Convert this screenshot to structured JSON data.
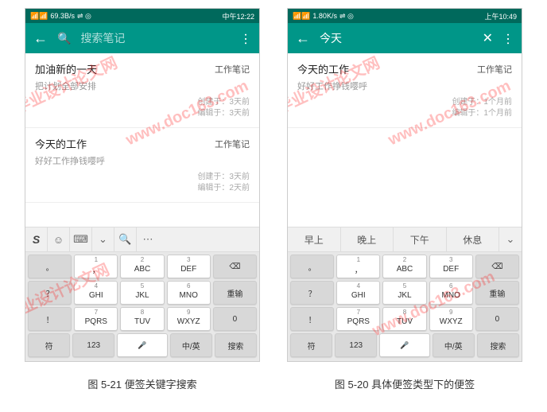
{
  "left": {
    "status": {
      "net": "69.3B/s",
      "icons": "⇌ ◎",
      "time": "中午12:22",
      "signal": "📶📶"
    },
    "toolbar": {
      "search_placeholder": "搜索笔记"
    },
    "notes": [
      {
        "title": "加油新的一天",
        "tag": "工作笔记",
        "sub": "把计划全部安排",
        "created": "创建于：3天前",
        "edited": "编辑于：3天前"
      },
      {
        "title": "今天的工作",
        "tag": "工作笔记",
        "sub": "好好工作挣钱嘤呼",
        "created": "创建于：3天前",
        "edited": "编辑于：2天前"
      }
    ],
    "suggest_icons": {
      "s": "S",
      "emoji": "☺",
      "kb": "⌨",
      "down": "⌄",
      "search": "🔍",
      "more": "⋯"
    }
  },
  "right": {
    "status": {
      "net": "1.80K/s",
      "icons": "⇌ ◎",
      "time": "上午10:49",
      "signal": "📶📶"
    },
    "toolbar": {
      "title": "今天"
    },
    "notes": [
      {
        "title": "今天的工作",
        "tag": "工作笔记",
        "sub": "好好工作挣钱嘤呼",
        "created": "创建于：1个月前",
        "edited": "编辑于：1个月前"
      }
    ],
    "suggest": [
      "早上",
      "晚上",
      "下午",
      "休息"
    ]
  },
  "keyboard": {
    "r1": [
      {
        "n": "1",
        "m": "，"
      },
      {
        "n": "2",
        "m": "ABC"
      },
      {
        "n": "3",
        "m": "DEF"
      }
    ],
    "r1_side": {
      "l": "。",
      "r": "⌫"
    },
    "r2": [
      {
        "n": "4",
        "m": "GHI"
      },
      {
        "n": "5",
        "m": "JKL"
      },
      {
        "n": "6",
        "m": "MNO"
      }
    ],
    "r2_side": {
      "l": "？",
      "r": "重输"
    },
    "r3": [
      {
        "n": "7",
        "m": "PQRS"
      },
      {
        "n": "8",
        "m": "TUV"
      },
      {
        "n": "9",
        "m": "WXYZ"
      }
    ],
    "r3_side": {
      "l": "！",
      "r": "0"
    },
    "r4": [
      "符",
      "123",
      "🎤",
      "中/英",
      "搜索"
    ]
  },
  "captions": {
    "left": "图 5-21 便签关键字搜索",
    "right": "图 5-20 具体便签类型下的便签"
  },
  "watermarks": [
    "毕业设计论文网",
    "www.doc163.com"
  ]
}
